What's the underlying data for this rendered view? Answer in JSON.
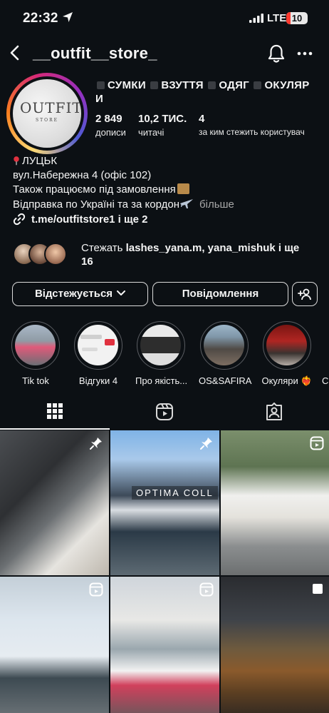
{
  "status_bar": {
    "time": "22:32",
    "network": "LTE",
    "battery": "10"
  },
  "header": {
    "username": "__outfit__store_"
  },
  "profile": {
    "avatar_brand": "OUTFIT",
    "avatar_sub": "STORE",
    "categories_line1": "СУМКИ",
    "categories_line2": "ВЗУТТЯ",
    "categories_line3": "ОДЯГ",
    "categories_line4": "ОКУЛЯР",
    "categories_line5": "И",
    "stats": [
      {
        "value": "2 849",
        "label": "дописи"
      },
      {
        "value": "10,2 ТИС.",
        "label": "читачі"
      },
      {
        "value": "4",
        "label": "за ким стежить користувач"
      }
    ],
    "bio": {
      "line1": "ЛУЦЬК",
      "line2": "вул.Набережна 4 (офіс 102)",
      "line3": "Також працюємо під замовлення",
      "line4": "Відправка по Україні та за кордон",
      "more": "більше"
    },
    "link": "t.me/outfitstore1 і ще 2",
    "followed_by": {
      "prefix": "Стежать ",
      "names": "lashes_yana.m, yana_mishuk",
      "suffix": " і ще",
      "count": "16"
    }
  },
  "buttons": {
    "following": "Відстежується",
    "message": "Повідомлення"
  },
  "highlights": [
    {
      "label": "Tik tok"
    },
    {
      "label": "Відгуки 4"
    },
    {
      "label": "Про якість..."
    },
    {
      "label": "OS&SAFIRA"
    },
    {
      "label": "Окуляри ❤️‍🔥"
    },
    {
      "label": "С"
    }
  ],
  "grid": {
    "post2_caption": "OPTIMA COLL"
  },
  "colors": {
    "background": "#0c1014",
    "text": "#f5f5f5",
    "muted": "#a8a8a8"
  }
}
